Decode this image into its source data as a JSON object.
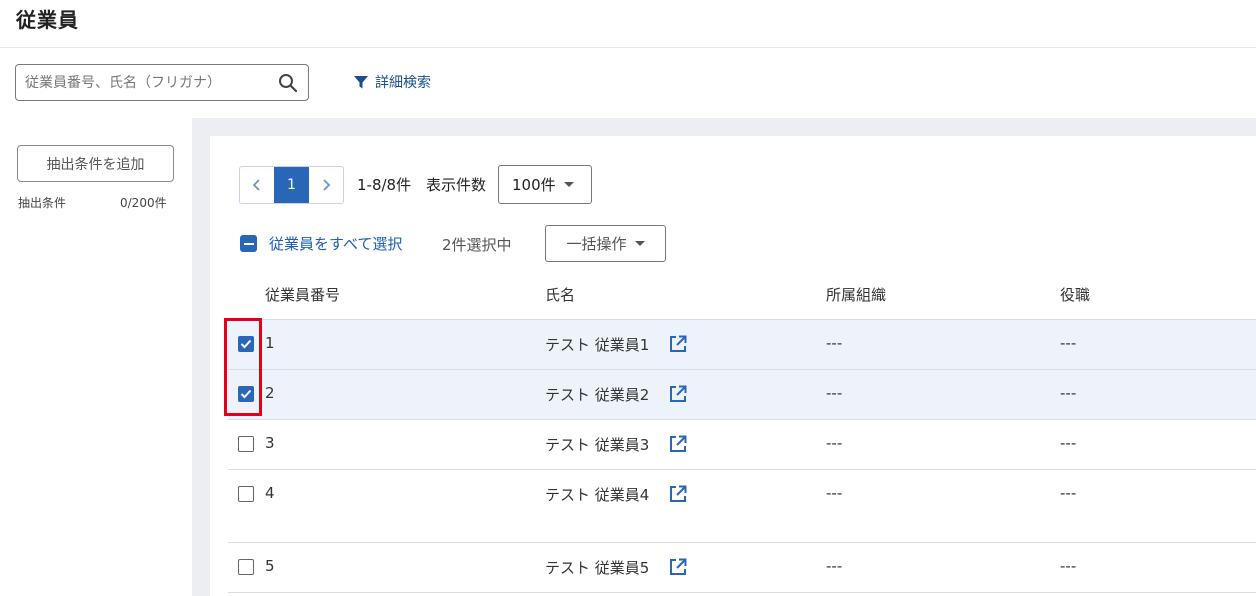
{
  "page": {
    "title": "従業員"
  },
  "search": {
    "placeholder": "従業員番号、氏名（フリガナ）",
    "value": ""
  },
  "advanced_search": {
    "label": "詳細検索"
  },
  "left_panel": {
    "add_condition_label": "抽出条件を追加",
    "condition_label": "抽出条件",
    "condition_count": "0/200件"
  },
  "pagination": {
    "current_page": "1",
    "range_text": "1-8/8件",
    "per_page_label": "表示件数",
    "per_page_value": "100件"
  },
  "selection": {
    "select_all_label": "従業員をすべて選択",
    "selected_count": "2件選択中",
    "bulk_action_label": "一括操作"
  },
  "table": {
    "columns": [
      "従業員番号",
      "氏名",
      "所属組織",
      "役職"
    ],
    "rows": [
      {
        "number": "1",
        "name": "テスト 従業員1",
        "org": "---",
        "position": "---",
        "checked": true
      },
      {
        "number": "2",
        "name": "テスト 従業員2",
        "org": "---",
        "position": "---",
        "checked": true
      },
      {
        "number": "3",
        "name": "テスト 従業員3",
        "org": "---",
        "position": "---",
        "checked": false
      },
      {
        "number": "4",
        "name": "テスト 従業員4",
        "org": "---",
        "position": "---",
        "checked": false
      },
      {
        "number": "5",
        "name": "テスト 従業員5",
        "org": "---",
        "position": "---",
        "checked": false
      }
    ]
  },
  "colors": {
    "accent": "#2a66b8",
    "link": "#1a5eb8",
    "selected_row_bg": "#eef3fb",
    "highlight": "#e3001b"
  }
}
